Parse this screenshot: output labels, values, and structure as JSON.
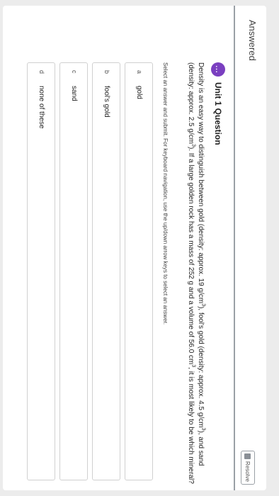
{
  "header": {
    "status": "Answered",
    "resolve_label": "Resolve",
    "resolve_icon": "document-icon"
  },
  "question": {
    "badge_icon": "ellipsis-icon",
    "badge_text": "...",
    "title": "Unit 1 Question",
    "text_1": "Density is an easy way to distinguish between gold (density: approx. 19 g/cm",
    "sup_1": "3",
    "text_2": "), fool's gold (density: approx. 4.5 g/cm",
    "sup_2": "3",
    "text_3": "), and sand (density: approx. 2.5 g/cm",
    "sup_3": "3",
    "text_4": "). If a large golden rock has a mass of 252 g and a volume of 56.0 cm",
    "sup_4": "3",
    "text_5": ", it is most likely to be which mineral?",
    "instructions": "Select an answer and submit. For keyboard navigation, use the up/down arrow keys to select an answer."
  },
  "options": [
    {
      "letter": "a",
      "label": "gold"
    },
    {
      "letter": "b",
      "label": "fool's gold"
    },
    {
      "letter": "c",
      "label": "sand"
    },
    {
      "letter": "d",
      "label": "none of these"
    }
  ],
  "colors": {
    "accent": "#7a3fc0",
    "divider": "#9aa0a6",
    "background": "#ececec"
  }
}
